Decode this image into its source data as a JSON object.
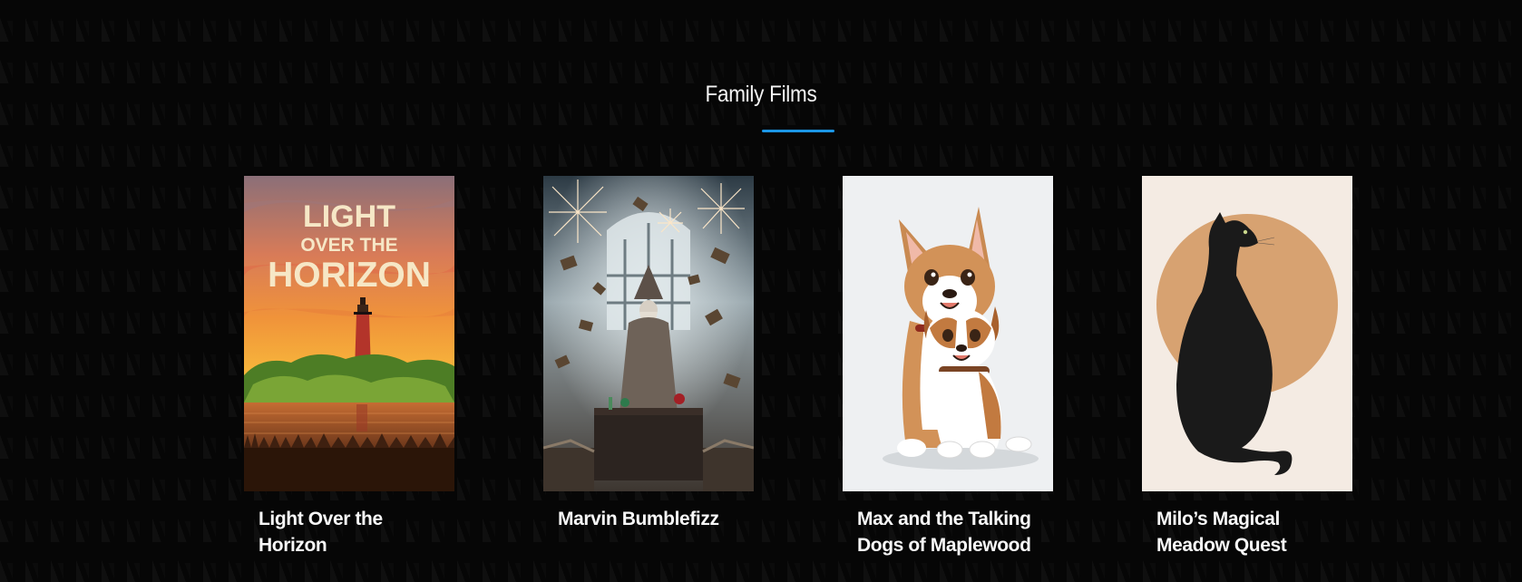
{
  "section": {
    "title": "Family Films",
    "accent_color": "#1b96e6"
  },
  "films": [
    {
      "title": "Light Over the Horizon",
      "poster_text": [
        "LIGHT",
        "OVER THE",
        "HORIZON"
      ],
      "poster_icon": "lighthouse-poster"
    },
    {
      "title": "Marvin Bumblefizz",
      "poster_icon": "wizard-poster"
    },
    {
      "title": "Max and the Talking Dogs of Maplewood",
      "poster_icon": "cartoon-dogs-poster"
    },
    {
      "title": "Milo’s Magical Meadow Quest",
      "poster_icon": "black-cat-poster"
    }
  ]
}
